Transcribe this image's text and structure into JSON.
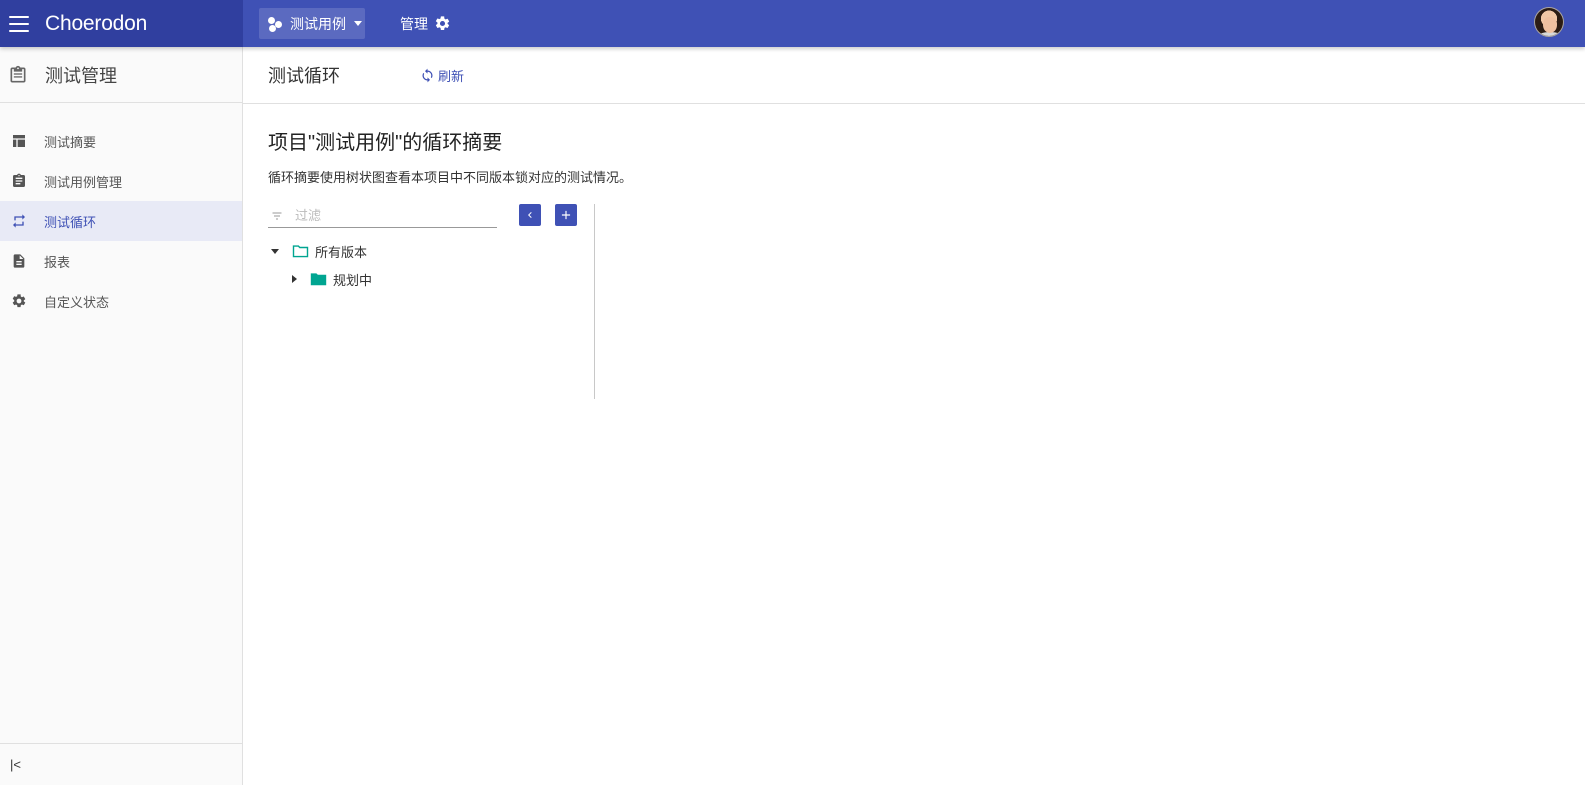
{
  "header": {
    "brand": "Choerodon",
    "project_name": "测试用例",
    "manage_label": "管理"
  },
  "sidebar": {
    "title": "测试管理",
    "items": [
      {
        "label": "测试摘要",
        "icon": "table-icon"
      },
      {
        "label": "测试用例管理",
        "icon": "clipboard-icon"
      },
      {
        "label": "测试循环",
        "icon": "repeat-icon",
        "active": true
      },
      {
        "label": "报表",
        "icon": "document-icon"
      },
      {
        "label": "自定义状态",
        "icon": "gear-icon"
      }
    ],
    "collapse_label": "|<"
  },
  "main": {
    "page_title": "测试循环",
    "refresh_label": "刷新",
    "content_title": "项目\"测试用例\"的循环摘要",
    "content_desc": "循环摘要使用树状图查看本项目中不同版本锁对应的测试情况。",
    "filter_placeholder": "过滤",
    "tree": [
      {
        "label": "所有版本",
        "expanded": true,
        "level": 0
      },
      {
        "label": "规划中",
        "expanded": false,
        "level": 1
      }
    ]
  },
  "colors": {
    "primary": "#3f51b5",
    "primary_dark": "#303f9f",
    "folder_teal": "#00a591"
  }
}
